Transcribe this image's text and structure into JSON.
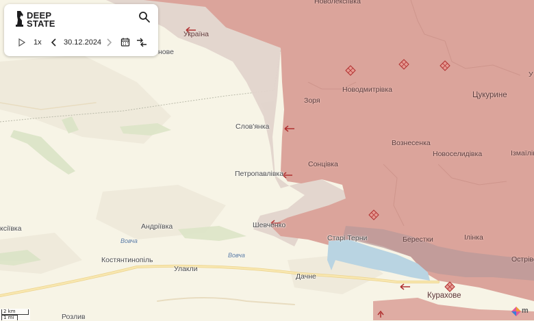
{
  "app": {
    "logo_line1": "DEEP",
    "logo_line2": "STATE"
  },
  "toolbar": {
    "play_icon": "play-icon",
    "speed": "1x",
    "date": "30.12.2024",
    "prev_icon": "chevron-left-icon",
    "next_icon": "chevron-right-icon",
    "calendar_icon": "calendar-icon",
    "compare_icon": "compare-arrows-icon",
    "search_icon": "search-icon"
  },
  "colors": {
    "occupied": "#dba49b",
    "contested": "#e2d4cc",
    "free_land": "#f7f4e6",
    "water": "#b9d4e2",
    "road": "#f1dc97"
  },
  "places": {
    "novooleksiivka": "Новолексіївка",
    "ukraina": "Україна",
    "nove": "нове",
    "zoria": "Зоря",
    "novodmytrivka": "Новодмитрівка",
    "tsukuryne": "Цукурине",
    "u_partial": "У",
    "slovianka": "Слов'янка",
    "voznesenka": "Вознесенка",
    "izmailivka": "Ізмаїлівк",
    "sontsivka": "Сонцівка",
    "novoselydivka": "Новоселидівка",
    "petropavlivka": "Петропавлівка",
    "andriivka": "Андріївка",
    "shevchenko": "Шевченко",
    "kasiivka": "ксіївка",
    "stari_terny": "Старі Терни",
    "berestky": "Берестки",
    "ilinka": "Ілінка",
    "kostiantynopil": "Костянтинопіль",
    "ostrivske": "Острівсь",
    "ulakly": "Улакли",
    "dachne": "Дачне",
    "kurakhove": "Курахове",
    "rozlyv": "Розлив"
  },
  "rivers": {
    "vovcha1": "Вовча",
    "vovcha2": "Вовча"
  },
  "scale": {
    "km": "2 km",
    "mi": "1 mi"
  },
  "attribution": {
    "text": "m"
  }
}
